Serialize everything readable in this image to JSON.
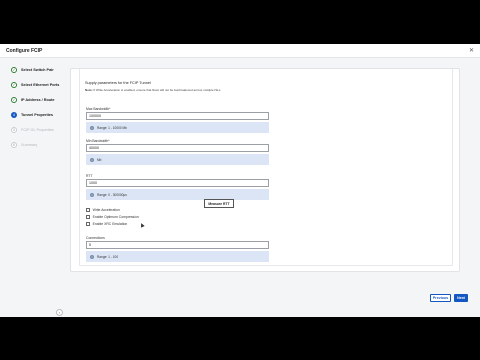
{
  "window": {
    "title": "Configure FCIP",
    "close_icon": "close-icon"
  },
  "sidebar": {
    "steps": [
      {
        "label": "Select Switch Pair",
        "status": "done",
        "marker": "✓"
      },
      {
        "label": "Select Ethernet Ports",
        "status": "done",
        "marker": "✓"
      },
      {
        "label": "IP Address / Route",
        "status": "done",
        "marker": "✓"
      },
      {
        "label": "Tunnel Properties",
        "status": "active",
        "marker": "4"
      },
      {
        "label": "FCIP-SL Properties",
        "status": "todo",
        "marker": "5"
      },
      {
        "label": "Summary",
        "status": "todo",
        "marker": "6"
      }
    ],
    "collapse_glyph": "‹"
  },
  "form": {
    "intro": "Supply parameters for the FCIP Tunnel",
    "note_label": "Note:",
    "note_text": "If Write Acceleration is enabled, ensure that flows will not be load balanced across multiple ISLs",
    "max_bw": {
      "label": "Max Bandwidth*",
      "value": "100000",
      "hint": "Range: 1 - 10000 Mb"
    },
    "min_bw": {
      "label": "Min Bandwidth*",
      "value": "40000",
      "hint": "Mb"
    },
    "rtt": {
      "label": "RTT",
      "value": "1000",
      "hint": "Range: 0 - 300000µs",
      "measure_label": "Measure RTT"
    },
    "checkboxes": [
      "Write Acceleration",
      "Enable Optimum Compression",
      "Enable XRC Emulation"
    ],
    "connections": {
      "label": "Connections",
      "value": "5",
      "hint": "Range: 1 - 100"
    }
  },
  "footer": {
    "previous_label": "Previous",
    "next_label": "Next"
  }
}
